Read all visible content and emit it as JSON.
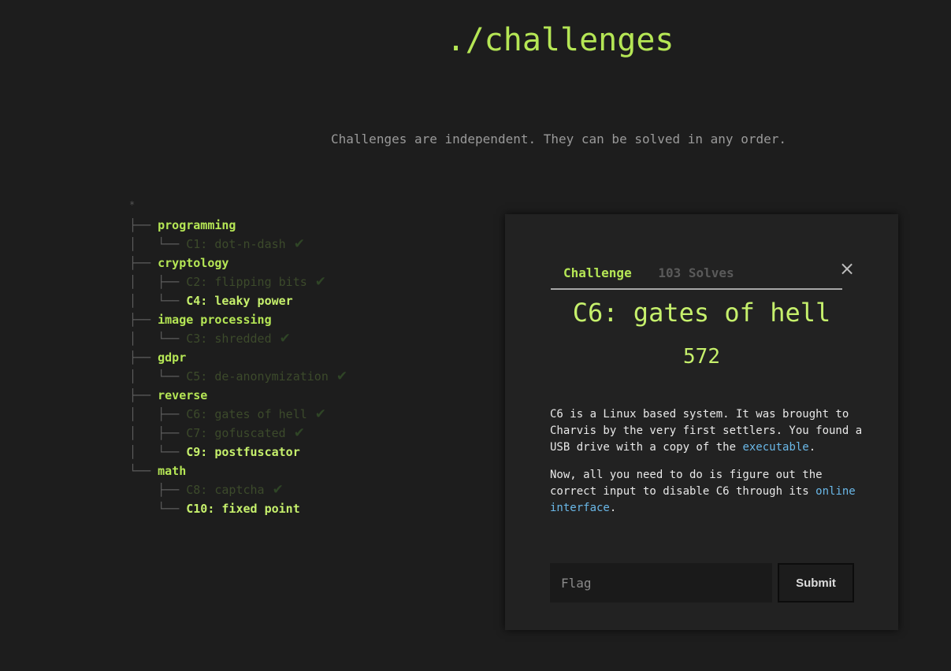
{
  "header": {
    "title": "./challenges",
    "subtitle": "Challenges are independent. They can be solved in any order."
  },
  "tree": {
    "root": "*",
    "rows": [
      {
        "prefix": "├── ",
        "kind": "category",
        "label": "programming"
      },
      {
        "prefix": "│   └── ",
        "kind": "challenge",
        "label": "C1: dot-n-dash",
        "solved": true
      },
      {
        "prefix": "├── ",
        "kind": "category",
        "label": "cryptology"
      },
      {
        "prefix": "│   ├── ",
        "kind": "challenge",
        "label": "C2: flipping bits",
        "solved": true
      },
      {
        "prefix": "│   └── ",
        "kind": "challenge",
        "label": "C4: leaky power",
        "solved": false
      },
      {
        "prefix": "├── ",
        "kind": "category",
        "label": "image processing"
      },
      {
        "prefix": "│   └── ",
        "kind": "challenge",
        "label": "C3: shredded",
        "solved": true
      },
      {
        "prefix": "├── ",
        "kind": "category",
        "label": "gdpr"
      },
      {
        "prefix": "│   └── ",
        "kind": "challenge",
        "label": "C5: de-anonymization",
        "solved": true
      },
      {
        "prefix": "├── ",
        "kind": "category",
        "label": "reverse"
      },
      {
        "prefix": "│   ├── ",
        "kind": "challenge",
        "label": "C6: gates of hell",
        "solved": true
      },
      {
        "prefix": "│   ├── ",
        "kind": "challenge",
        "label": "C7: gofuscated",
        "solved": true
      },
      {
        "prefix": "│   └── ",
        "kind": "challenge",
        "label": "C9: postfuscator",
        "solved": false
      },
      {
        "prefix": "└── ",
        "kind": "category",
        "label": "math"
      },
      {
        "prefix": "    ├── ",
        "kind": "challenge",
        "label": "C8: captcha",
        "solved": true
      },
      {
        "prefix": "    └── ",
        "kind": "challenge",
        "label": "C10: fixed point",
        "solved": false
      }
    ]
  },
  "modal": {
    "tab_challenge": "Challenge",
    "tab_solves": "103 Solves",
    "close_symbol": "×",
    "title": "C6: gates of hell",
    "points": "572",
    "desc_p1_text": "C6 is a Linux based system. It was brought to Charvis by the very first settlers. You found a USB drive with a copy of the ",
    "desc_p1_link": "executable",
    "desc_p1_end": ".",
    "desc_p2_text": "Now, all you need to do is figure out the correct input to disable C6 through its ",
    "desc_p2_link": "online interface",
    "desc_p2_end": ".",
    "flag_placeholder": "Flag",
    "flag_value": "",
    "submit_label": "Submit"
  },
  "colors": {
    "accent": "#b5e655",
    "background": "#1d1d1d",
    "modal_background": "#222222",
    "link": "#6ab8e8",
    "solved": "#3c4a2b"
  },
  "icons": {
    "solved": "check-icon",
    "close": "close-icon"
  }
}
